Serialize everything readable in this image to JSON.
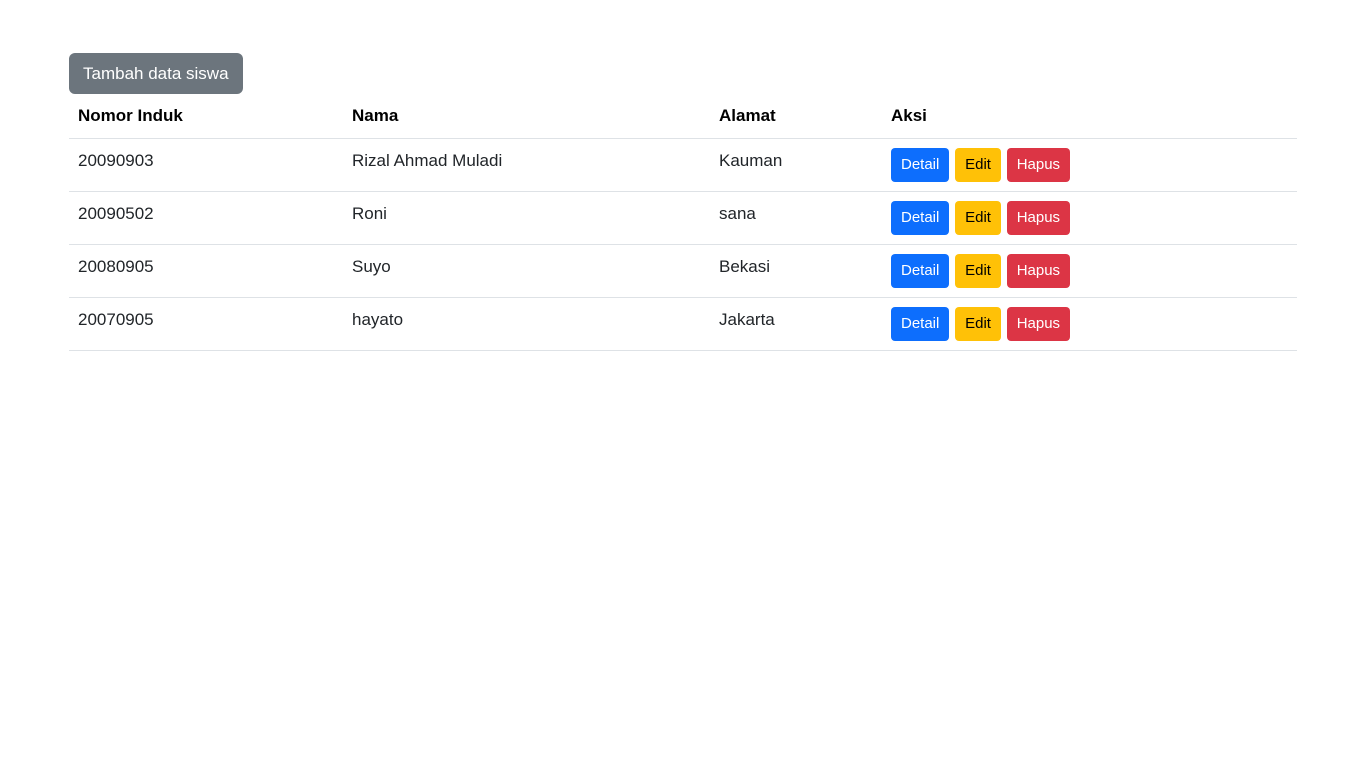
{
  "toolbar": {
    "add_label": "Tambah data siswa"
  },
  "table": {
    "headers": [
      "Nomor Induk",
      "Nama",
      "Alamat",
      "Aksi"
    ],
    "rows": [
      {
        "nomor": "20090903",
        "nama": "Rizal Ahmad Muladi",
        "alamat": "Kauman"
      },
      {
        "nomor": "20090502",
        "nama": "Roni",
        "alamat": "sana"
      },
      {
        "nomor": "20080905",
        "nama": "Suyo",
        "alamat": "Bekasi"
      },
      {
        "nomor": "20070905",
        "nama": "hayato",
        "alamat": "Jakarta"
      }
    ],
    "actions": {
      "detail": "Detail",
      "edit": "Edit",
      "hapus": "Hapus"
    }
  },
  "colors": {
    "add_button": "#6c757d",
    "detail_button": "#0d6efd",
    "edit_button": "#ffc107",
    "hapus_button": "#dc3545"
  }
}
